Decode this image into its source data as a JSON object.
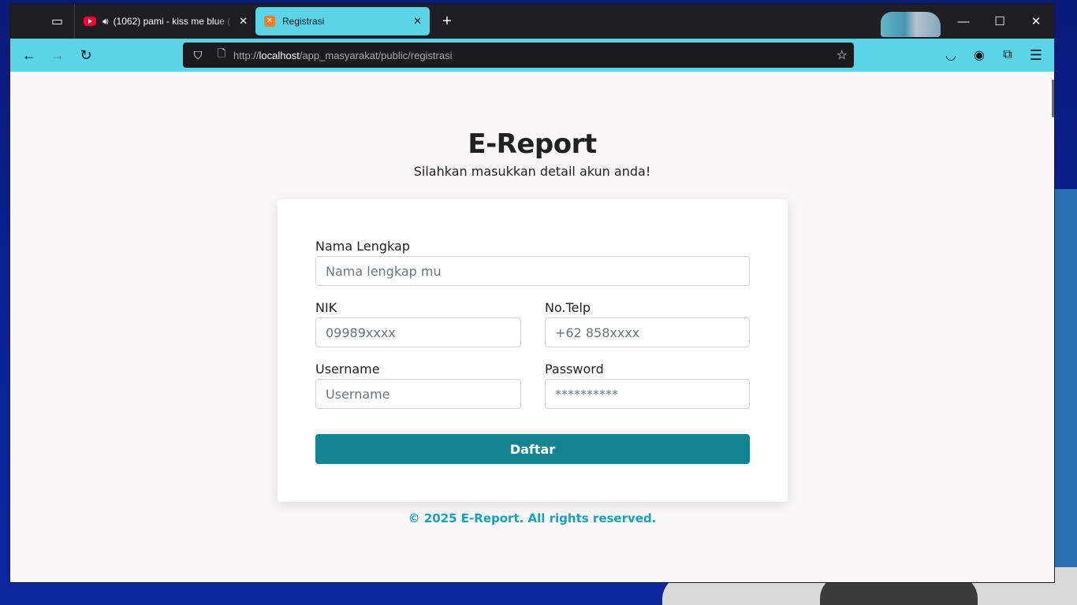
{
  "browser": {
    "tabs": [
      {
        "title": "(1062) pami - kiss me blue (",
        "favicon": "youtube-icon",
        "audio": "speaker-icon",
        "active": false
      },
      {
        "title": "Registrasi",
        "favicon": "xampp-icon",
        "active": true
      }
    ],
    "url": {
      "scheme": "http://",
      "host": "localhost",
      "path": "/app_masyarakat/public/registrasi"
    },
    "accent": "#5cd4e8"
  },
  "page": {
    "title": "E-Report",
    "subtitle": "Silahkan masukkan detail akun anda!",
    "form": {
      "nama": {
        "label": "Nama Lengkap",
        "placeholder": "Nama lengkap mu"
      },
      "nik": {
        "label": "NIK",
        "placeholder": "09989xxxx"
      },
      "telp": {
        "label": "No.Telp",
        "placeholder": "+62 858xxxx"
      },
      "username": {
        "label": "Username",
        "placeholder": "Username"
      },
      "password": {
        "label": "Password",
        "placeholder": "**********"
      },
      "submit_label": "Daftar"
    },
    "footer": "© 2025 E-Report. All rights reserved.",
    "colors": {
      "button": "#148493",
      "footer": "#17a2b8"
    }
  }
}
